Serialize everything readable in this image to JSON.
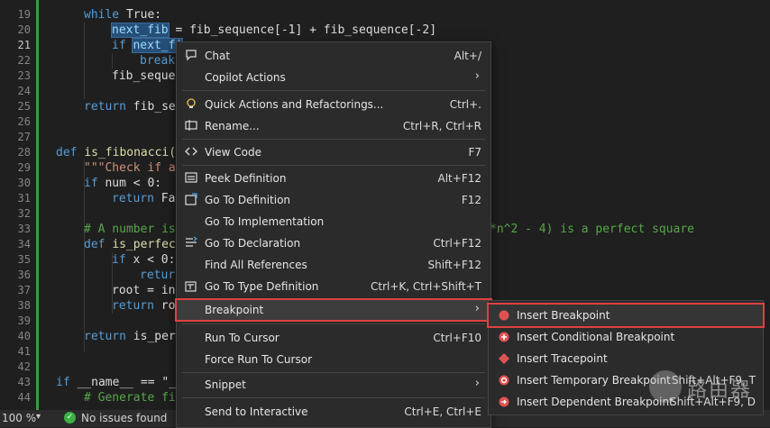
{
  "editor": {
    "line_numbers": [
      "19",
      "20",
      "21",
      "22",
      "23",
      "24",
      "25",
      "26",
      "27",
      "28",
      "29",
      "30",
      "31",
      "32",
      "33",
      "34",
      "35",
      "36",
      "37",
      "38",
      "39",
      "40",
      "41",
      "42",
      "43",
      "44"
    ],
    "lines": {
      "l19_kw": "while",
      "l19_rest": " True:",
      "l20_var": "next_fib",
      "l20_rest": " = fib_sequence[-1] + fib_sequence[-2]",
      "l21_kw": "if",
      "l21_var": "next_fi",
      "l22_kw": "break",
      "l23": "fib_seque",
      "l25_kw": "return",
      "l25_rest": " fib_seq",
      "l28_kw": "def",
      "l28_fn": "is_fibonacci(",
      "l29_str": "\"\"\"Check if a",
      "l30_kw": "if",
      "l30_rest": " num < 0:",
      "l31_kw": "return",
      "l31_rest": " Fal",
      "l33_cm": "# A number is",
      "l33_cm2": "*n^2 - 4) is a perfect square",
      "l34_kw": "def",
      "l34_fn": "is_perfect",
      "l35_kw": "if",
      "l35_rest": " x < 0:",
      "l36_kw": "retur",
      "l37_rest": "root = int",
      "l38_kw": "return",
      "l38_rest": " roo",
      "l40_kw": "return",
      "l40_rest": " is_per",
      "l43_kw": "if",
      "l43_rest": " __name__ == \"_",
      "l44_cm": "# Generate fi"
    }
  },
  "statusbar": {
    "zoom": "100 %",
    "zoom_arrow": "▾",
    "issues": "No issues found",
    "check": "✓"
  },
  "context_menu": {
    "items": [
      {
        "label": "Chat",
        "shortcut": "Alt+/",
        "icon": "chat-icon"
      },
      {
        "label": "Copilot Actions",
        "arrow": "›"
      },
      {
        "label": "Quick Actions and Refactorings...",
        "shortcut": "Ctrl+.",
        "icon": "lightbulb-icon"
      },
      {
        "label": "Rename...",
        "shortcut": "Ctrl+R, Ctrl+R",
        "icon": "rename-icon"
      },
      {
        "label": "View Code",
        "shortcut": "F7",
        "icon": "code-icon"
      },
      {
        "label": "Peek Definition",
        "shortcut": "Alt+F12",
        "icon": "peek-icon"
      },
      {
        "label": "Go To Definition",
        "shortcut": "F12",
        "icon": "goto-definition-icon"
      },
      {
        "label": "Go To Implementation",
        "shortcut": ""
      },
      {
        "label": "Go To Declaration",
        "shortcut": "Ctrl+F12",
        "icon": "goto-declaration-icon"
      },
      {
        "label": "Find All References",
        "shortcut": "Shift+F12"
      },
      {
        "label": "Go To Type Definition",
        "shortcut": "Ctrl+K, Ctrl+Shift+T",
        "icon": "type-definition-icon"
      },
      {
        "label": "Breakpoint",
        "arrow": "›"
      },
      {
        "label": "Run To Cursor",
        "shortcut": "Ctrl+F10"
      },
      {
        "label": "Force Run To Cursor",
        "shortcut": ""
      },
      {
        "label": "Snippet",
        "arrow": "›"
      },
      {
        "label": "Send to Interactive",
        "shortcut": "Ctrl+E, Ctrl+E"
      }
    ]
  },
  "breakpoint_submenu": {
    "items": [
      {
        "label": "Insert Breakpoint",
        "shortcut": "",
        "color": "#e05252"
      },
      {
        "label": "Insert Conditional Breakpoint",
        "shortcut": "",
        "color": "#e05252"
      },
      {
        "label": "Insert Tracepoint",
        "shortcut": "",
        "color": "#e05252"
      },
      {
        "label": "Insert Temporary Breakpoint",
        "shortcut": "Shift+Alt+F9, T",
        "color": "#e05252"
      },
      {
        "label": "Insert Dependent Breakpoint",
        "shortcut": "Shift+Alt+F9, D",
        "color": "#e05252"
      }
    ]
  },
  "watermark": {
    "text": "路由器"
  },
  "colors": {
    "highlight_outline": "#e04040",
    "menu_bg": "#2b2b2b",
    "editor_bg": "#1f1f1f"
  }
}
